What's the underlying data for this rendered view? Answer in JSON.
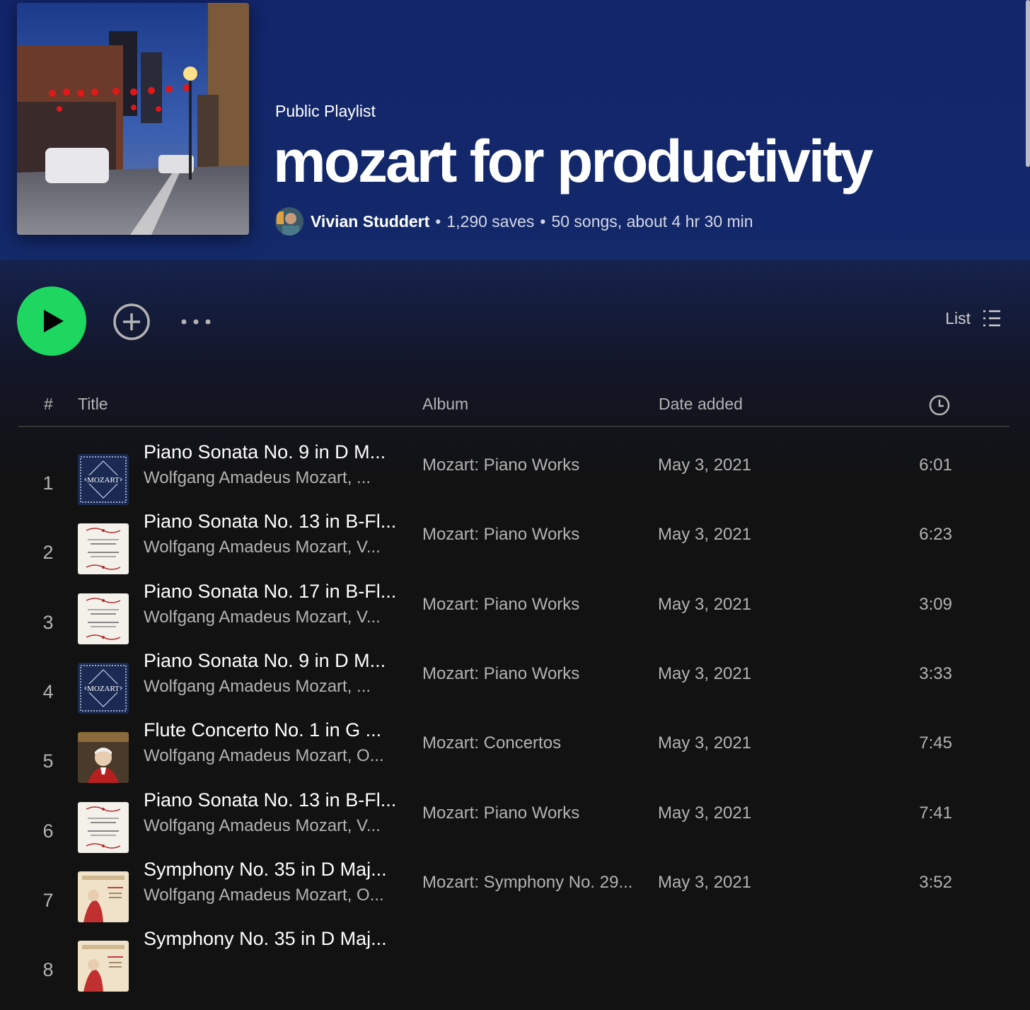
{
  "header": {
    "type_label": "Public Playlist",
    "title": "mozart for productivity",
    "owner": "Vivian Studdert",
    "saves": "1,290 saves",
    "summary": "50 songs, about 4 hr 30 min",
    "separator": "•"
  },
  "actions": {
    "view_label": "List"
  },
  "columns": {
    "number": "#",
    "title": "Title",
    "album": "Album",
    "date_added": "Date added"
  },
  "tracks": [
    {
      "num": "1",
      "title": "Piano Sonata No. 9 in D M...",
      "artist": "Wolfgang Amadeus Mozart, ...",
      "album": "Mozart: Piano Works",
      "date": "May 3, 2021",
      "duration": "6:01",
      "art": "mozart-blue"
    },
    {
      "num": "2",
      "title": "Piano Sonata No. 13 in B-Fl...",
      "artist": "Wolfgang Amadeus Mozart, V...",
      "album": "Mozart: Piano Works",
      "date": "May 3, 2021",
      "duration": "6:23",
      "art": "piano-works-white"
    },
    {
      "num": "3",
      "title": "Piano Sonata No. 17 in B-Fl...",
      "artist": "Wolfgang Amadeus Mozart, V...",
      "album": "Mozart: Piano Works",
      "date": "May 3, 2021",
      "duration": "3:09",
      "art": "piano-works-white"
    },
    {
      "num": "4",
      "title": "Piano Sonata No. 9 in D M...",
      "artist": "Wolfgang Amadeus Mozart, ...",
      "album": "Mozart: Piano Works",
      "date": "May 3, 2021",
      "duration": "3:33",
      "art": "mozart-blue"
    },
    {
      "num": "5",
      "title": "Flute Concerto No. 1 in G ...",
      "artist": "Wolfgang Amadeus Mozart, O...",
      "album": "Mozart: Concertos",
      "date": "May 3, 2021",
      "duration": "7:45",
      "art": "mozart-portrait"
    },
    {
      "num": "6",
      "title": "Piano Sonata No. 13 in B-Fl...",
      "artist": "Wolfgang Amadeus Mozart, V...",
      "album": "Mozart: Piano Works",
      "date": "May 3, 2021",
      "duration": "7:41",
      "art": "piano-works-white"
    },
    {
      "num": "7",
      "title": "Symphony No. 35 in D Maj...",
      "artist": "Wolfgang Amadeus Mozart, O...",
      "album": "Mozart: Symphony No. 29...",
      "date": "May 3, 2021",
      "duration": "3:52",
      "art": "symphony-cream"
    },
    {
      "num": "8",
      "title": "Symphony No. 35 in D Maj...",
      "artist": "",
      "album": "",
      "date": "",
      "duration": "",
      "art": "symphony-cream"
    }
  ],
  "colors": {
    "header_bg": "#13256b",
    "accent_green": "#1ed760",
    "body_bg": "#121212",
    "muted_text": "#b3b3b3"
  }
}
